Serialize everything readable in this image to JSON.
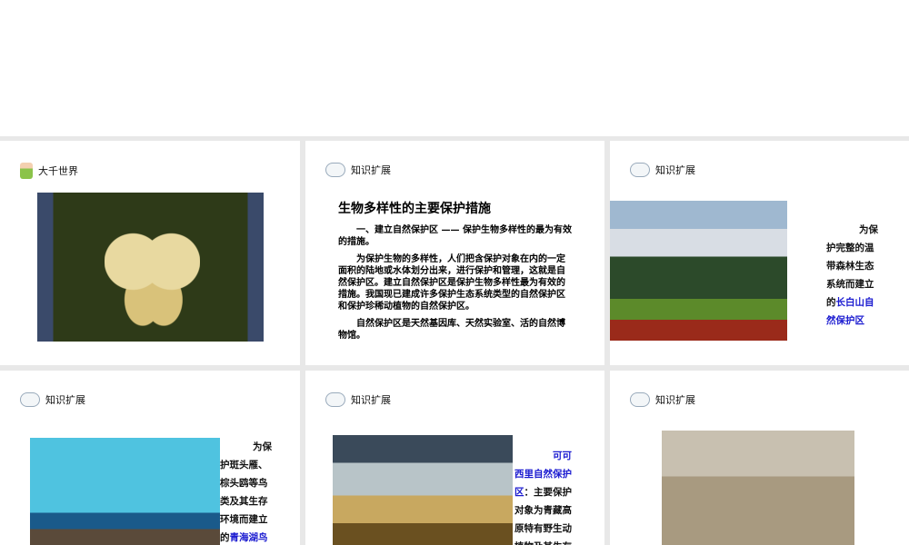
{
  "slides": [
    {
      "title": "大千世界"
    },
    {
      "title": "知识扩展",
      "heading": "生物多样性的主要保护措施",
      "p1": "一、建立自然保护区 —— 保护生物多样性的最为有效的措施。",
      "p2": "为保护生物的多样性，人们把含保护对象在内的一定面积的陆地或水体划分出来，进行保护和管理，这就是自然保护区。建立自然保护区是保护生物多样性最为有效的措施。我国现已建成许多保护生态系统类型的自然保护区和保护珍稀动植物的自然保护区。",
      "p3": "自然保护区是天然基因库、天然实验室、活的自然博物馆。"
    },
    {
      "title": "知识扩展",
      "text": "为保护完整的温带森林生态系统而建立的",
      "highlight": "长白山自然保护区"
    },
    {
      "title": "知识扩展",
      "text": "为保护斑头雁、棕头鸥等鸟类及其生存环境而建立的",
      "highlight": "青海湖鸟"
    },
    {
      "title": "知识扩展",
      "highlight": "可可西里自然保护区",
      "text": "：主要保护对象为青藏高原特有野生动植物及其生存"
    },
    {
      "title": "知识扩展"
    }
  ]
}
